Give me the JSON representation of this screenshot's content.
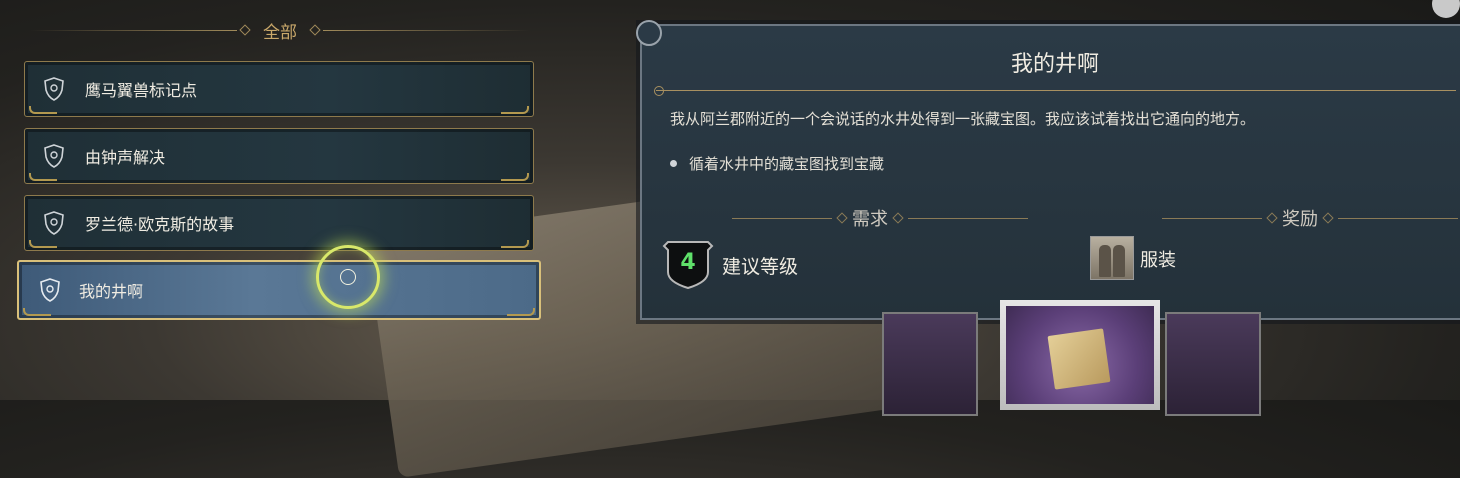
{
  "list": {
    "header": "全部",
    "items": [
      {
        "label": "鹰马翼兽标记点",
        "selected": false
      },
      {
        "label": "由钟声解决",
        "selected": false
      },
      {
        "label": "罗兰德·欧克斯的故事",
        "selected": false
      },
      {
        "label": "我的井啊",
        "selected": true
      }
    ]
  },
  "detail": {
    "title": "我的井啊",
    "description": "我从阿兰郡附近的一个会说话的水井处得到一张藏宝图。我应该试着找出它通向的地方。",
    "objective": "循着水井中的藏宝图找到宝藏",
    "requirements": {
      "heading": "需求",
      "level": "4",
      "label": "建议等级"
    },
    "rewards": {
      "heading": "奖励",
      "item_label": "服装"
    }
  },
  "colors": {
    "accent_gold": "#c9a86a",
    "selected_border": "#d9c07a",
    "level_green": "#5fe06a",
    "panel_bg": "#2b3a46"
  }
}
